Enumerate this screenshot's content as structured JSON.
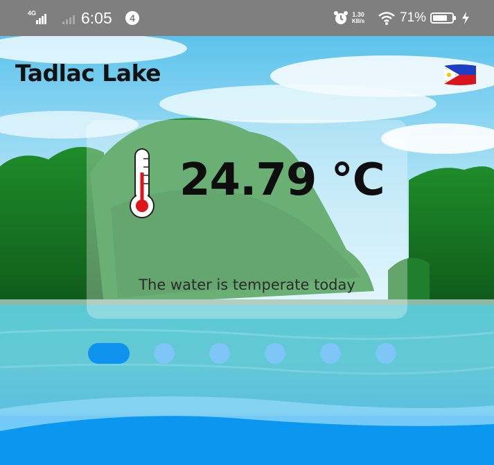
{
  "status_bar": {
    "network": "4G",
    "time": "6:05",
    "notification_count": "4",
    "speed_value": "1.30",
    "speed_unit": "KB/s",
    "battery": "71%"
  },
  "header": {
    "title": "Tadlac Lake",
    "flag_icon": "philippines-flag-icon"
  },
  "temperature_card": {
    "value": "24.79 °C",
    "message": "The water is temperate today",
    "icon": "thermometer-icon"
  },
  "pager": {
    "count": 6,
    "active_index": 0
  },
  "colors": {
    "accent": "#0d93ee",
    "dot_inactive": "#7dc6f7",
    "thermometer_red": "#e0121a"
  }
}
